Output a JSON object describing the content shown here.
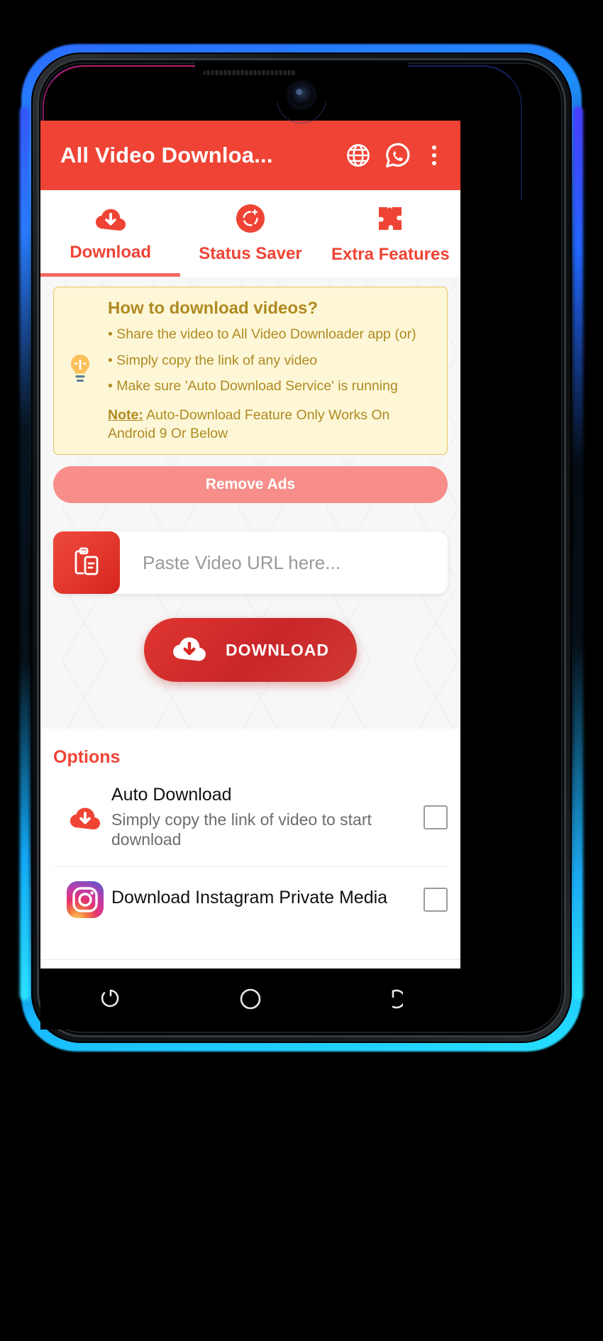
{
  "appbar": {
    "title": "All Video Downloa...",
    "icons": [
      "globe-icon",
      "whatsapp-icon",
      "overflow-menu-icon"
    ]
  },
  "tabs": [
    {
      "label": "Download",
      "icon": "cloud-download-icon",
      "active": true
    },
    {
      "label": "Status Saver",
      "icon": "status-saver-icon",
      "active": false
    },
    {
      "label": "Extra Features",
      "icon": "puzzle-piece-icon",
      "active": false
    }
  ],
  "tip_card": {
    "icon": "lightbulb-icon",
    "title": "How to download videos?",
    "bullets": [
      "• Share the video to All Video Downloader app (or)",
      "• Simply copy the link of any video",
      "• Make sure 'Auto Download Service' is running"
    ],
    "note_label": "Note:",
    "note_text": " Auto-Download Feature Only Works On Android 9 Or Below"
  },
  "remove_ads": {
    "label": "Remove Ads"
  },
  "url_row": {
    "paste_icon": "clipboard-paste-icon",
    "placeholder": "Paste Video URL here...",
    "value": ""
  },
  "download_button": {
    "label": "DOWNLOAD",
    "icon": "cloud-download-icon"
  },
  "options": {
    "title": "Options",
    "items": [
      {
        "icon": "cloud-download-icon",
        "name": "Auto Download",
        "desc": "Simply copy the link of video to start download",
        "checked": false
      },
      {
        "icon": "instagram-icon",
        "name": "Download Instagram Private Media",
        "desc": "",
        "checked": false
      }
    ]
  },
  "navbar": {
    "buttons": [
      {
        "name": "recents-button",
        "icon": "recents-icon"
      },
      {
        "name": "home-button",
        "icon": "home-circle-icon"
      },
      {
        "name": "back-button",
        "icon": "back-icon"
      }
    ]
  },
  "colors": {
    "brand_red": "#ef4435",
    "deep_red": "#d6261f",
    "tip_bg": "#fdf7d7",
    "tip_border": "#e8c261",
    "tip_text": "#b08a22",
    "remove_ads_bg": "#f78e8a"
  }
}
